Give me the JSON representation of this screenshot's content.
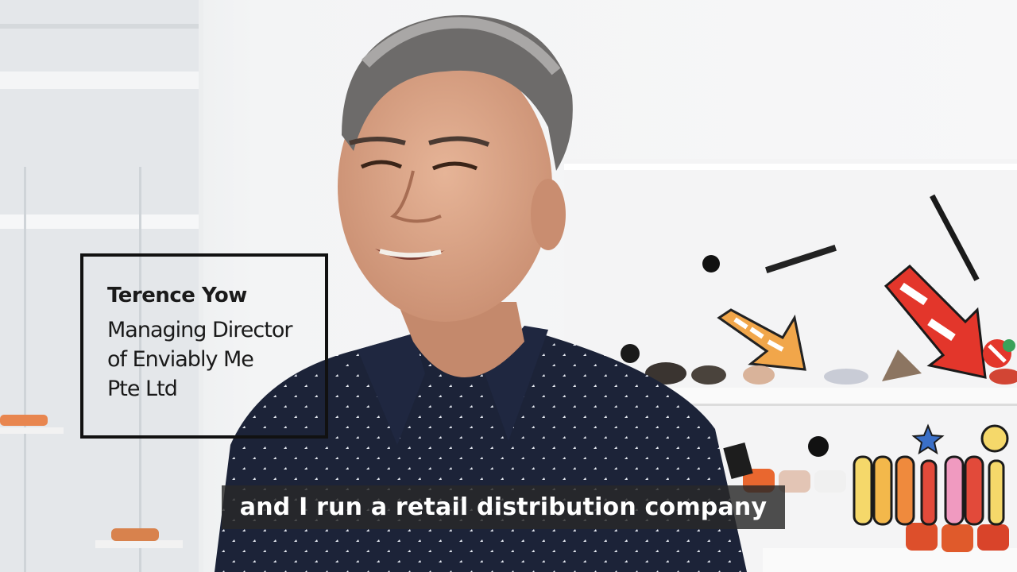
{
  "lower_third": {
    "name": "Terence Yow",
    "role_lines": [
      "Managing Director",
      "of Enviably Me",
      "Pte Ltd"
    ]
  },
  "subtitle": "and I run a retail distribution company",
  "colors": {
    "shirt": "#1b2236",
    "wall": "#f1f2f3",
    "accent_orange": "#ef7b2d",
    "accent_red": "#e3362b"
  }
}
